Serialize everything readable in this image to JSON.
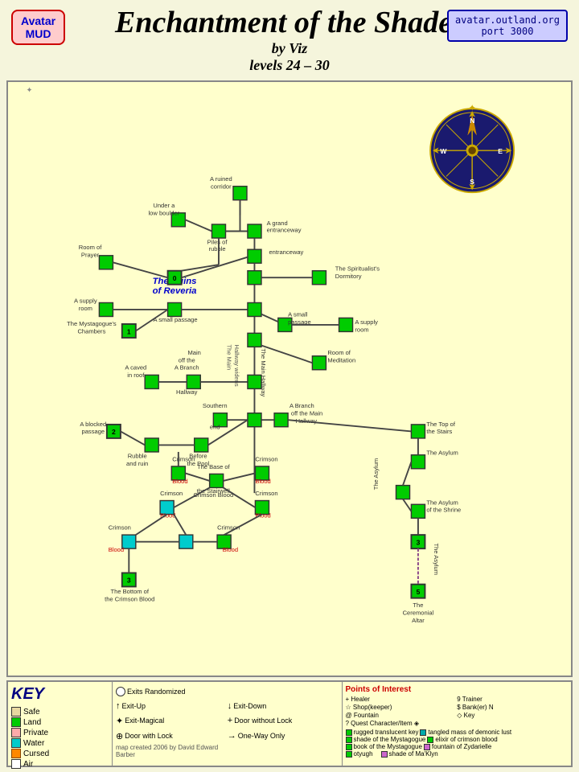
{
  "header": {
    "title": "Enchantment of the Shades",
    "by": "by Viz",
    "levels": "levels 24 – 30",
    "avatar_line1": "Avatar",
    "avatar_line2": "MUD",
    "server_line1": "avatar.outland.org",
    "server_line2": "port 3000"
  },
  "legend": {
    "key_title": "KEY",
    "items": [
      {
        "color": "tan",
        "label": "Safe"
      },
      {
        "color": "green",
        "label": "Land"
      },
      {
        "color": "pink",
        "label": "Private"
      },
      {
        "color": "cyan",
        "label": "Water"
      },
      {
        "color": "orange",
        "label": "Cursed"
      },
      {
        "color": "white",
        "label": "Air"
      }
    ],
    "symbols": [
      "Exits Randomized",
      "Exit-Up",
      "Exit-Down",
      "Exit-Magical",
      "Door without Lock",
      "Door with Lock",
      "One-Way Only"
    ],
    "poi_title": "Points of Interest",
    "poi_items": [
      "+ Healer",
      "9 Trainer",
      "$ Shop(keeper)",
      "$ Bank(er)",
      "N",
      "@ Fountain",
      "◇ Key",
      "? Quest Character/Item",
      "◈",
      "rugged translucent key",
      "shade of the Mystagogue",
      "book of the Mystagogue",
      "otyugh",
      "tangled mass of demonic lust",
      "elixir of crimson blood",
      "fountain of Zydarielle",
      "shade of Ma'Klyn"
    ]
  },
  "map_credit": "map created 2006 by David Edward Barber"
}
